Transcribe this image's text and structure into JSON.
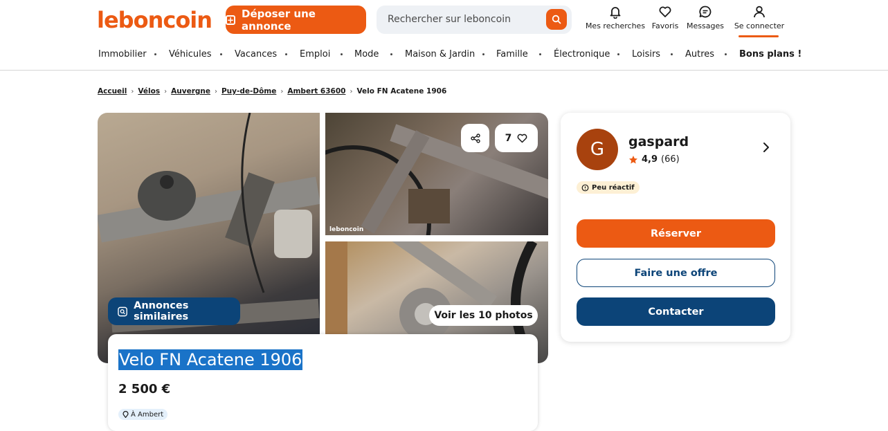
{
  "header": {
    "logo": "leboncoin",
    "deposit_label": "Déposer une annonce",
    "search_placeholder": "Rechercher sur leboncoin",
    "nav": [
      {
        "label": "Mes recherches",
        "icon": "bell-icon"
      },
      {
        "label": "Favoris",
        "icon": "heart-icon"
      },
      {
        "label": "Messages",
        "icon": "chat-icon"
      },
      {
        "label": "Se connecter",
        "icon": "user-icon"
      }
    ]
  },
  "categories": [
    "Immobilier",
    "Véhicules",
    "Vacances",
    "Emploi",
    "Mode",
    "Maison & Jardin",
    "Famille",
    "Électronique",
    "Loisirs",
    "Autres",
    "Bons plans !"
  ],
  "breadcrumb": [
    "Accueil",
    "Vélos",
    "Auvergne",
    "Puy-de-Dôme",
    "Ambert 63600",
    "Velo FN Acatene 1906"
  ],
  "gallery": {
    "watermark": "leboncoin",
    "favorites_count": "7",
    "similar_label": "Annonces similaires",
    "photos_label": "Voir les 10 photos"
  },
  "ad": {
    "title": "Velo FN Acatene 1906",
    "price": "2 500 €",
    "location": "À Ambert"
  },
  "seller": {
    "initial": "G",
    "name": "gaspard",
    "rating": "4,9",
    "reviews": "(66)",
    "reactivity": "Peu réactif",
    "reserve_label": "Réserver",
    "offer_label": "Faire une offre",
    "contact_label": "Contacter"
  },
  "colors": {
    "brand": "#ec5a13",
    "navy": "#0c4478"
  }
}
